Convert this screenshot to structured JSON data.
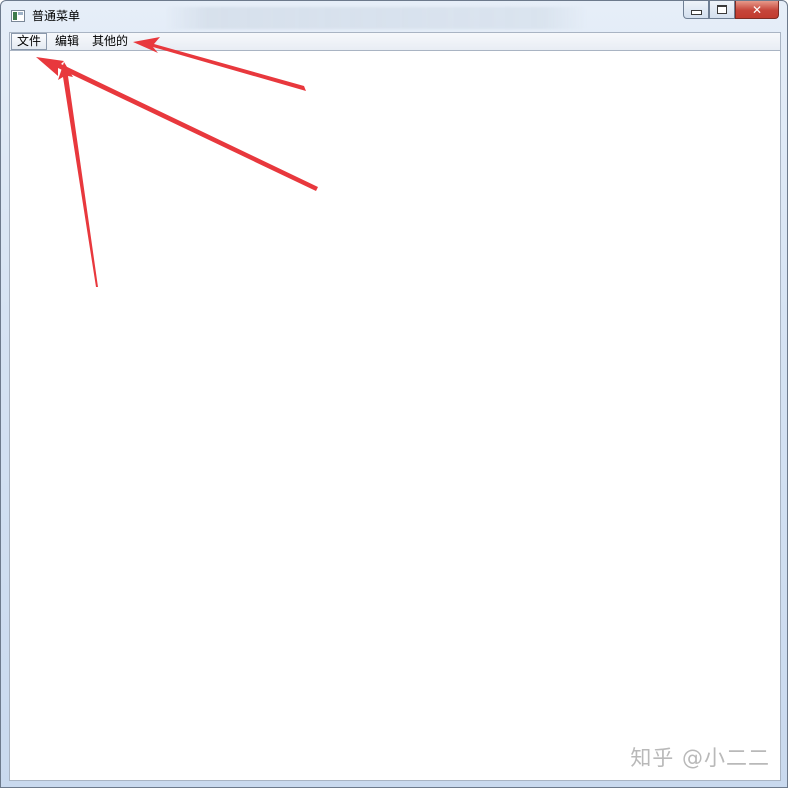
{
  "window": {
    "title": "普通菜单"
  },
  "menubar": {
    "items": [
      {
        "label": "文件"
      },
      {
        "label": "编辑"
      },
      {
        "label": "其他的"
      }
    ]
  },
  "watermark": "知乎 @小二二",
  "colors": {
    "arrow": "#e8383d",
    "close_button": "#c6453a"
  },
  "icons": {
    "app": "window-app-icon",
    "minimize": "minimize-icon",
    "maximize": "maximize-icon",
    "close": "close-icon"
  }
}
